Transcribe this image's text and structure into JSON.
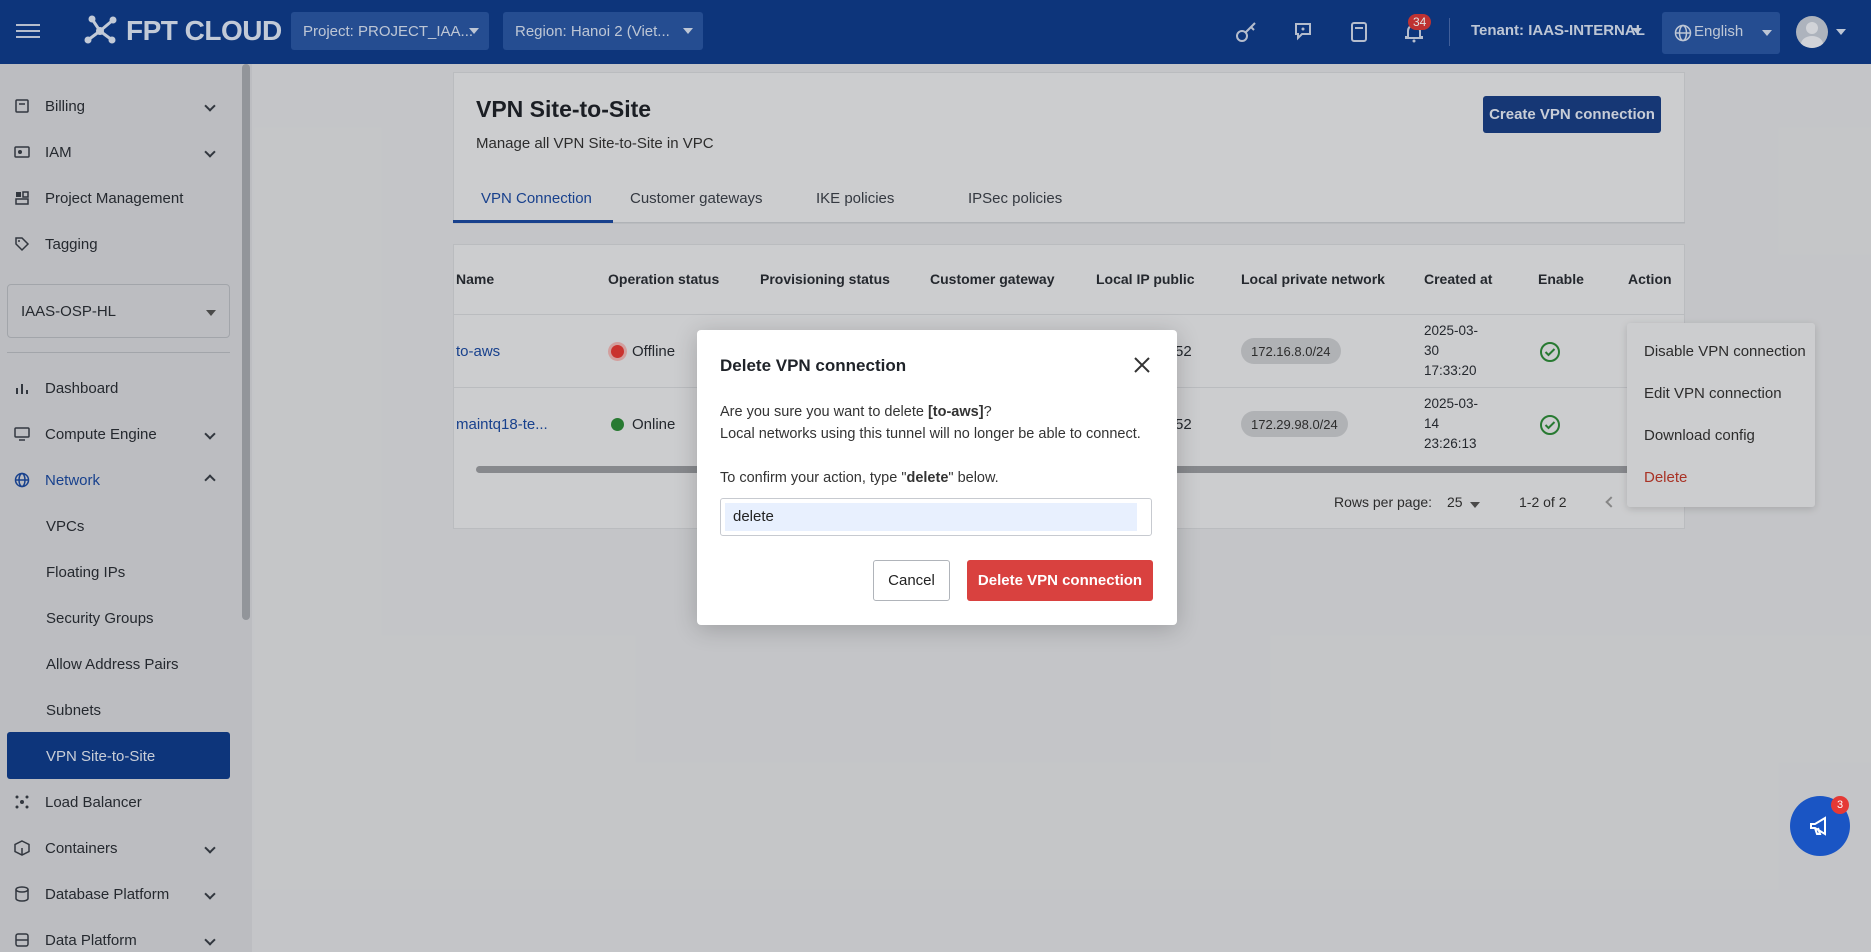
{
  "header": {
    "logo_text": "FPT CLOUD",
    "project_select": "Project: PROJECT_IAA...",
    "region_select": "Region: Hanoi 2 (Viet...",
    "notification_count": "34",
    "tenant": "Tenant: IAAS-INTERNAL",
    "language": "English"
  },
  "sidebar": {
    "top_items": [
      {
        "label": "Billing",
        "icon": "billing-icon"
      },
      {
        "label": "IAM",
        "icon": "iam-icon"
      },
      {
        "label": "Project Management",
        "icon": "project-icon"
      },
      {
        "label": "Tagging",
        "icon": "tag-icon"
      }
    ],
    "project_select": "IAAS-OSP-HL",
    "items": [
      {
        "label": "Dashboard",
        "icon": "chart-icon"
      },
      {
        "label": "Compute Engine",
        "icon": "monitor-icon"
      },
      {
        "label": "Network",
        "icon": "globe-icon"
      }
    ],
    "network_sub": [
      "VPCs",
      "Floating IPs",
      "Security Groups",
      "Allow Address Pairs",
      "Subnets",
      "VPN Site-to-Site"
    ],
    "bottom_items": [
      {
        "label": "Load Balancer",
        "icon": "balancer-icon"
      },
      {
        "label": "Containers",
        "icon": "container-icon"
      },
      {
        "label": "Database Platform",
        "icon": "database-icon"
      },
      {
        "label": "Data Platform",
        "icon": "data-icon"
      }
    ]
  },
  "page": {
    "title": "VPN Site-to-Site",
    "subtitle": "Manage all VPN Site-to-Site in VPC",
    "create_button": "Create VPN connection",
    "tabs": [
      "VPN Connection",
      "Customer gateways",
      "IKE policies",
      "IPSec policies"
    ]
  },
  "table": {
    "headers": [
      "Name",
      "Operation status",
      "Provisioning status",
      "Customer gateway",
      "Local IP public",
      "Local private network",
      "Created at",
      "Enable",
      "Action"
    ],
    "rows": [
      {
        "name": "to-aws",
        "status": "Offline",
        "status_color": "#e53935",
        "local_ip_tail": "52",
        "private_network": "172.16.8.0/24",
        "created_at": [
          "2025-03-",
          "30",
          "17:33:20"
        ]
      },
      {
        "name": "maintq18-te...",
        "status": "Online",
        "status_color": "#2e8b3a",
        "local_ip_tail": "52",
        "private_network": "172.29.98.0/24",
        "created_at": [
          "2025-03-",
          "14",
          "23:26:13"
        ]
      }
    ],
    "rows_per_page_label": "Rows per page:",
    "rows_per_page": "25",
    "range": "1-2 of 2"
  },
  "action_menu": [
    "Disable VPN connection",
    "Edit VPN connection",
    "Download config",
    "Delete"
  ],
  "modal": {
    "title": "Delete VPN connection",
    "line1_prefix": "Are you sure you want to delete ",
    "line1_name": "[to-aws]",
    "line1_suffix": "?",
    "line2": "Local networks using this tunnel will no longer be able to connect.",
    "confirm_prefix": "To confirm your action, type \"",
    "confirm_word": "delete",
    "confirm_suffix": "\" below.",
    "input_value": "delete",
    "cancel_label": "Cancel",
    "delete_label": "Delete VPN connection"
  },
  "fab_badge": "3"
}
